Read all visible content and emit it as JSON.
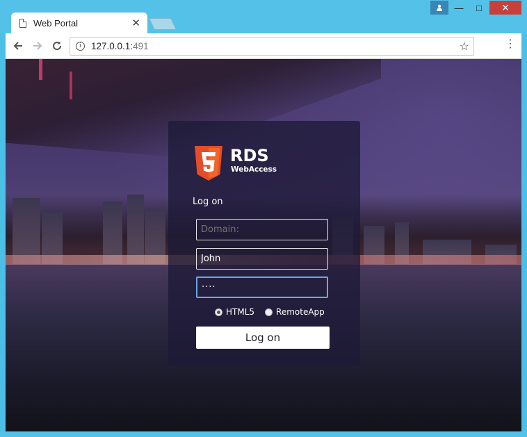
{
  "window": {
    "controls": {
      "minimize": "—",
      "maximize": "□",
      "close": "✕"
    }
  },
  "tab": {
    "title": "Web Portal",
    "close_label": "✕"
  },
  "toolbar": {
    "url_host": "127.0.0.1:",
    "url_port": "491",
    "icons": [
      "back-arrow-icon",
      "forward-arrow-icon",
      "reload-icon",
      "info-icon",
      "star-icon",
      "menu-icon"
    ]
  },
  "login": {
    "brand_title": "RDS",
    "brand_subtitle": "WebAccess",
    "logo_number": "5",
    "heading": "Log on",
    "domain_placeholder": "Domain:",
    "username_value": "John",
    "password_value": "····",
    "options": [
      {
        "label": "HTML5",
        "selected": true
      },
      {
        "label": "RemoteApp",
        "selected": false
      }
    ],
    "submit_label": "Log on"
  },
  "colors": {
    "chrome": "#54c1e8",
    "logo_orange": "#e44d26",
    "focus_border": "#6aa7e6",
    "close_button": "#c7403a"
  }
}
